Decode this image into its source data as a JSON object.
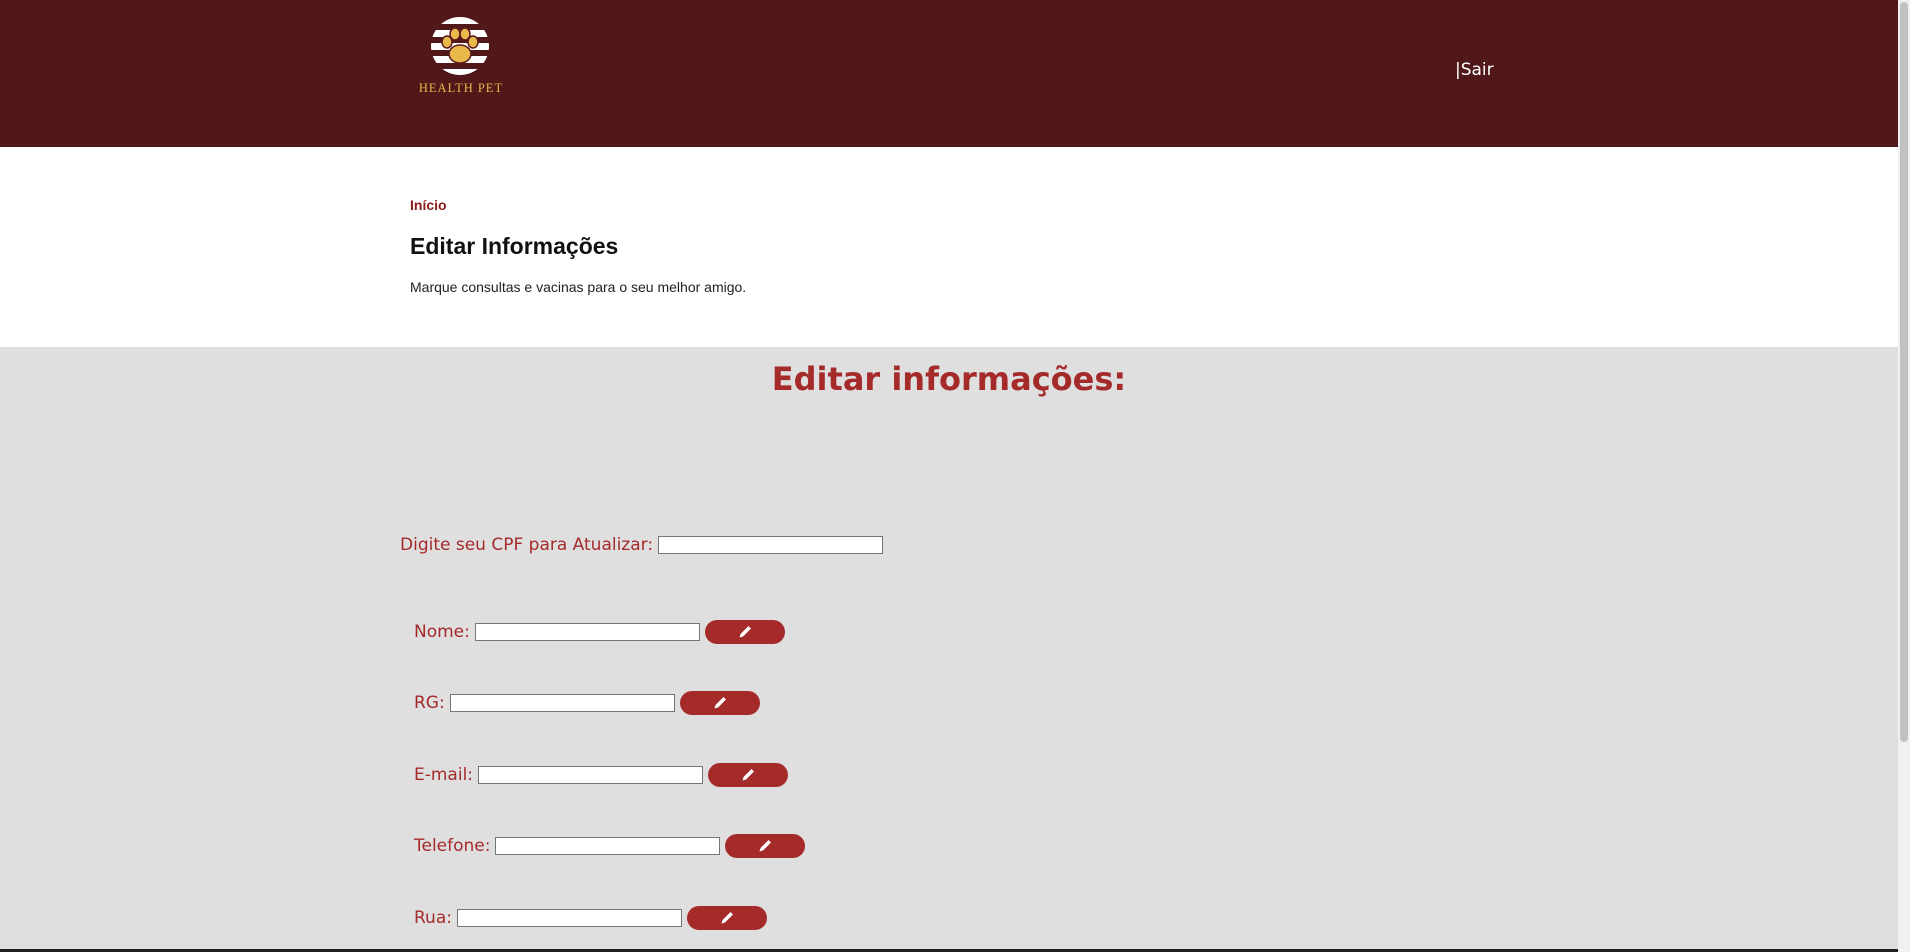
{
  "header": {
    "logo_text": "HEALTH PET",
    "logout_label": "|Sair"
  },
  "page": {
    "breadcrumb": "Início",
    "title": "Editar Informações",
    "subtitle": "Marque consultas e vacinas para o seu melhor amigo."
  },
  "form": {
    "heading": "Editar informações:",
    "cpf_label": "Digite seu CPF para Atualizar:",
    "cpf_value": "",
    "fields": [
      {
        "label": "Nome:",
        "value": ""
      },
      {
        "label": "RG:",
        "value": ""
      },
      {
        "label": "E-mail:",
        "value": ""
      },
      {
        "label": "Telefone:",
        "value": ""
      },
      {
        "label": "Rua:",
        "value": ""
      }
    ],
    "edit_icon": "pencil-icon"
  },
  "colors": {
    "header_bg": "#511819",
    "accent": "#a52a2a",
    "logo_gold": "#e8b84a",
    "content_bg": "#dfdfdf"
  }
}
